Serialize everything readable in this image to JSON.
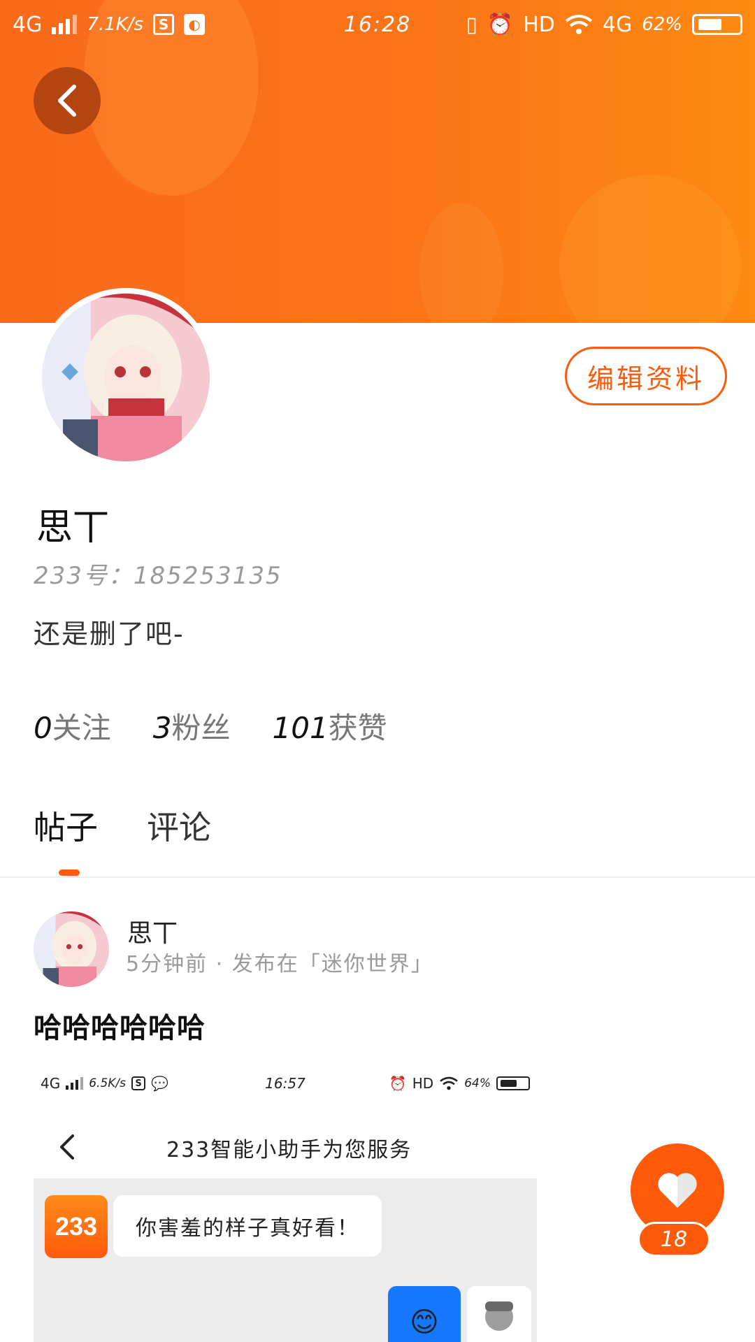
{
  "statusbar": {
    "network": "4G",
    "speed": "7.1K/s",
    "time": "16:28",
    "hd": "HD",
    "network_right": "4G",
    "battery": "62%",
    "battery_level": 0.62
  },
  "profile": {
    "name": "思丅",
    "id_label": "233号：",
    "id_value": "185253135",
    "bio": "还是删了吧-",
    "edit_label": "编辑资料"
  },
  "stats": [
    {
      "num": "0",
      "label": "关注"
    },
    {
      "num": "3",
      "label": "粉丝"
    },
    {
      "num": "101",
      "label": "获赞"
    }
  ],
  "tabs": [
    {
      "label": "帖子",
      "active": true
    },
    {
      "label": "评论",
      "active": false
    }
  ],
  "post": {
    "author": "思丅",
    "time": "5分钟前",
    "dot": "·",
    "published_in": "发布在「迷你世界」",
    "body": "哈哈哈哈哈哈"
  },
  "embedded_shot": {
    "network": "4G",
    "speed": "6.5K/s",
    "time": "16:57",
    "hd": "HD",
    "battery": "64%",
    "battery_level": 0.64,
    "title": "233智能小助手为您服务",
    "logo": "233",
    "message": "你害羞的样子真好看！",
    "emoji": "😊"
  },
  "like": {
    "count": "18"
  },
  "colors": {
    "accent": "#ff5a0a",
    "banner_start": "#f96a1c",
    "banner_end": "#fd8a13"
  }
}
